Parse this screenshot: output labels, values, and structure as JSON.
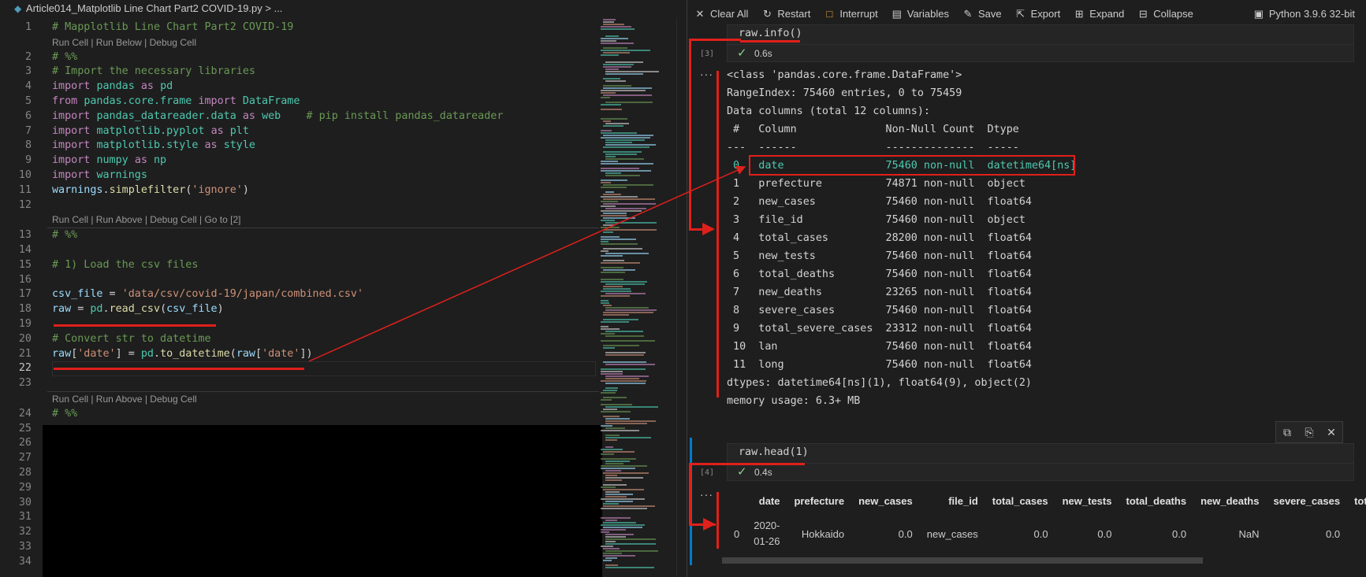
{
  "editor": {
    "breadcrumb": "Article014_Matplotlib Line Chart Part2 COVID-19.py > ...",
    "lens_run_below": "Run Cell | Run Below | Debug Cell",
    "lens_run_above_goto": "Run Cell | Run Above | Debug Cell | Go to [2]",
    "lens_run_above": "Run Cell | Run Above | Debug Cell",
    "line_numbers": [
      "1",
      "2",
      "3",
      "4",
      "5",
      "6",
      "7",
      "8",
      "9",
      "10",
      "11",
      "12",
      "13",
      "14",
      "15",
      "16",
      "17",
      "18",
      "19",
      "20",
      "21",
      "22",
      "23",
      "24",
      "25",
      "26",
      "27",
      "28",
      "29",
      "30",
      "31",
      "32",
      "33",
      "34"
    ],
    "lines": {
      "l1": "# Mapplotlib Line Chart Part2 COVID-19",
      "l2": "# %%",
      "l3": "# Import the necessary libraries",
      "l4_kw": "import",
      "l4_mod": "pandas",
      "l4_as": "as",
      "l4_alias": "pd",
      "l5_from": "from",
      "l5_mod": "pandas.core.frame",
      "l5_imp": "import",
      "l5_name": "DataFrame",
      "l6_kw": "import",
      "l6_mod": "pandas_datareader.data",
      "l6_as": "as",
      "l6_alias": "web",
      "l6_comment": "# pip install pandas_datareader",
      "l7_kw": "import",
      "l7_mod": "matplotlib.pyplot",
      "l7_as": "as",
      "l7_alias": "plt",
      "l8_kw": "import",
      "l8_mod": "matplotlib.style",
      "l8_as": "as",
      "l8_alias": "style",
      "l9_kw": "import",
      "l9_mod": "numpy",
      "l9_as": "as",
      "l9_alias": "np",
      "l10_kw": "import",
      "l10_mod": "warnings",
      "l11_obj": "warnings",
      "l11_fn": "simplefilter",
      "l11_str": "'ignore'",
      "l13": "# %%",
      "l15": "# 1) Load the csv files",
      "l17_var": "csv_file",
      "l17_str": "'data/csv/covid-19/japan/combined.csv'",
      "l18_var": "raw",
      "l18_obj": "pd",
      "l18_fn": "read_csv",
      "l18_arg": "csv_file",
      "l20": "# Convert str to datetime",
      "l21_var": "raw",
      "l21_key": "'date'",
      "l21_obj": "pd",
      "l21_fn": "to_datetime",
      "l21_arg": "raw",
      "l24": "# %%"
    }
  },
  "toolbar": {
    "clear_all": "Clear All",
    "restart": "Restart",
    "interrupt": "Interrupt",
    "variables": "Variables",
    "save": "Save",
    "export": "Export",
    "expand": "Expand",
    "collapse": "Collapse",
    "kernel": "Python 3.9.6 32-bit"
  },
  "cell3": {
    "source": "raw.info()",
    "exec_count": "[3]",
    "time": "0.6s",
    "output": [
      "<class 'pandas.core.frame.DataFrame'>",
      "RangeIndex: 75460 entries, 0 to 75459",
      "Data columns (total 12 columns):",
      " #   Column              Non-Null Count  Dtype",
      "---  ------              --------------  -----",
      " 0   date                75460 non-null  datetime64[ns]",
      " 1   prefecture          74871 non-null  object",
      " 2   new_cases           75460 non-null  float64",
      " 3   file_id             75460 non-null  object",
      " 4   total_cases         28200 non-null  float64",
      " 5   new_tests           75460 non-null  float64",
      " 6   total_deaths        75460 non-null  float64",
      " 7   new_deaths          23265 non-null  float64",
      " 8   severe_cases        75460 non-null  float64",
      " 9   total_severe_cases  23312 non-null  float64",
      " 10  lan                 75460 non-null  float64",
      " 11  long                75460 non-null  float64",
      "dtypes: datetime64[ns](1), float64(9), object(2)",
      "memory usage: 6.3+ MB"
    ]
  },
  "cell4": {
    "source": "raw.head(1)",
    "exec_count": "[4]",
    "time": "0.4s",
    "columns": [
      "",
      "date",
      "prefecture",
      "new_cases",
      "file_id",
      "total_cases",
      "new_tests",
      "total_deaths",
      "new_deaths",
      "severe_cases",
      "tota"
    ],
    "row": [
      "0",
      "2020-01-26",
      "Hokkaido",
      "0.0",
      "new_cases",
      "0.0",
      "0.0",
      "0.0",
      "NaN",
      "0.0",
      ""
    ]
  },
  "annotation_color": "#e0201b"
}
